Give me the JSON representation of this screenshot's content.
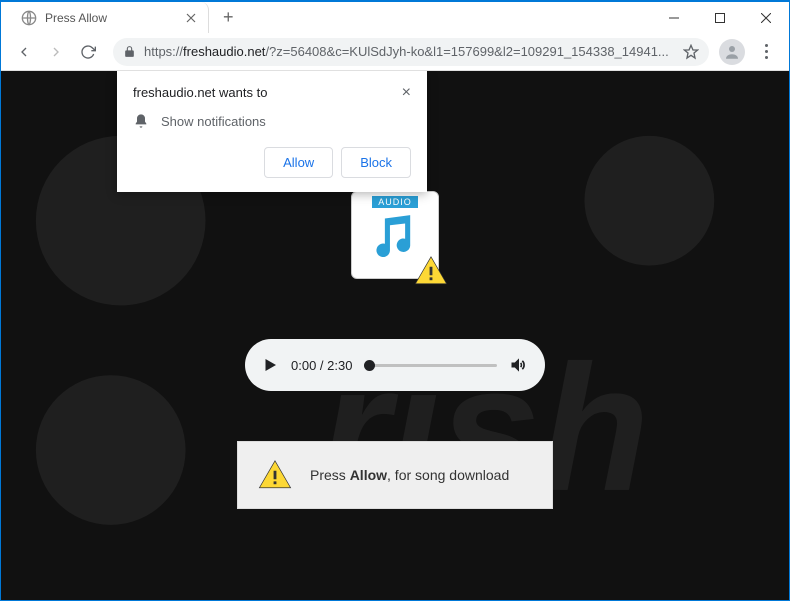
{
  "window": {
    "tab_title": "Press Allow",
    "url_scheme": "https://",
    "url_host": "freshaudio.net",
    "url_path": "/?z=56408&c=KUlSdJyh-ko&l1=157699&l2=109291_154338_14941..."
  },
  "notification": {
    "title": "freshaudio.net wants to",
    "body": "Show notifications",
    "allow_label": "Allow",
    "block_label": "Block"
  },
  "audio_card": {
    "label": "AUDIO"
  },
  "player": {
    "current": "0:00",
    "sep": " / ",
    "duration": "2:30"
  },
  "cta": {
    "prefix": "Press ",
    "bold": "Allow",
    "suffix": ", for song download"
  }
}
